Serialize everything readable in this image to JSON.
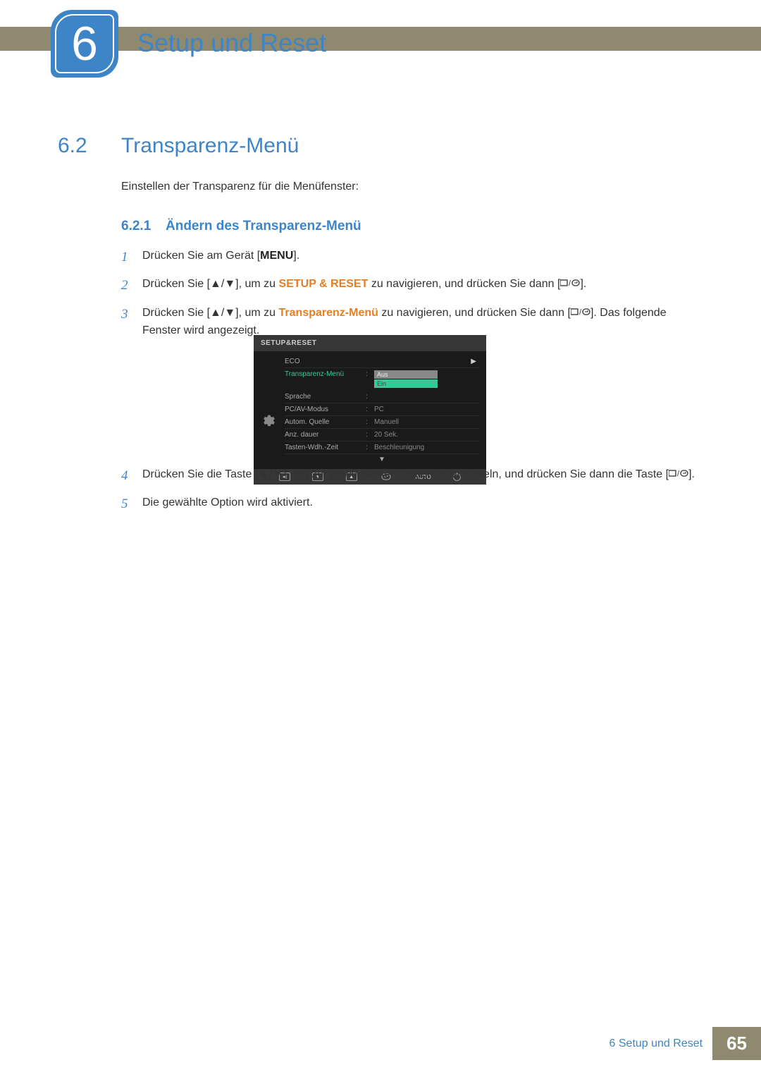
{
  "chapter": {
    "number": "6",
    "title": "Setup und Reset"
  },
  "section": {
    "number": "6.2",
    "title": "Transparenz-Menü"
  },
  "intro": "Einstellen der Transparenz für die Menüfenster:",
  "subsection": {
    "number": "6.2.1",
    "title": "Ändern des Transparenz-Menü"
  },
  "steps": {
    "s1_a": "Drücken Sie am Gerät [",
    "s1_b": "].",
    "menu_key": "MENU",
    "s2_a": "Drücken Sie [",
    "s2_b": "], um zu ",
    "s2_target": "SETUP & RESET",
    "s2_c": " zu navigieren, und drücken Sie dann [",
    "s2_d": "].",
    "s3_a": "Drücken Sie [",
    "s3_b": "], um zu ",
    "s3_target": "Transparenz-Menü",
    "s3_c": " zu navigieren, und drücken Sie dann [",
    "s3_d": "]. Das folgende Fenster wird angezeigt.",
    "s4_a": "Drücken Sie die Taste [",
    "s4_b": "], um zur gewünschten Option zu wechseln, und drücken Sie dann die Taste [",
    "s4_c": "].",
    "s5": "Die gewählte Option wird aktiviert.",
    "n1": "1",
    "n2": "2",
    "n3": "3",
    "n4": "4",
    "n5": "5"
  },
  "osd": {
    "header": "SETUP&RESET",
    "items": [
      {
        "label": "ECO",
        "value": "",
        "arrow": "▶"
      },
      {
        "label": "Transparenz-Menü",
        "active": true,
        "select": [
          "Aus",
          "Ein"
        ],
        "selected": 0
      },
      {
        "label": "Sprache",
        "value": ""
      },
      {
        "label": "PC/AV-Modus",
        "value": "PC"
      },
      {
        "label": "Autom. Quelle",
        "value": "Manuell"
      },
      {
        "label": "Anz. dauer",
        "value": "20 Sek."
      },
      {
        "label": "Tasten-Wdh.-Zeit",
        "value": "Beschleunigung"
      }
    ],
    "footer_auto": "AUTO",
    "footer_arrows": {
      "left": "◀",
      "down": "▼",
      "up": "▲"
    }
  },
  "footer": {
    "chapter_ref": "6 Setup und Reset",
    "page": "65"
  }
}
